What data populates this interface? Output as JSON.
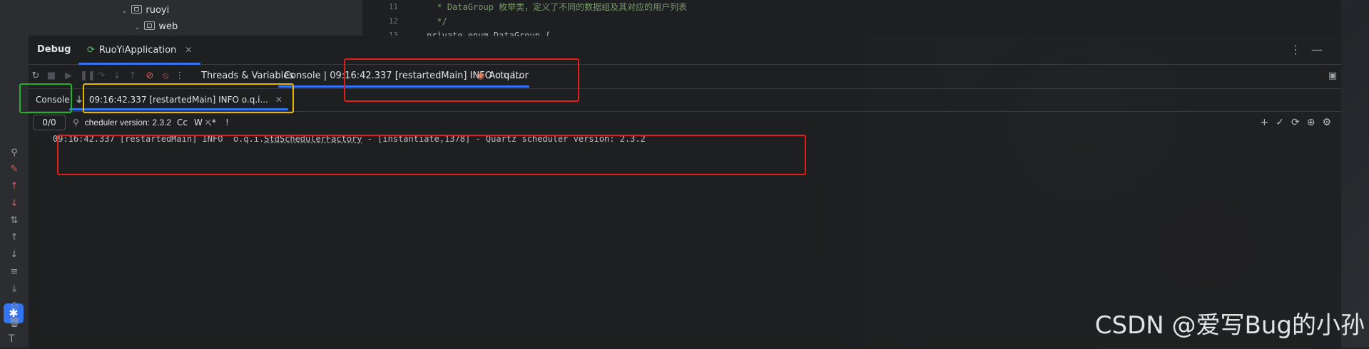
{
  "project_tree": {
    "items": [
      {
        "label": "ruoyi"
      },
      {
        "label": "web"
      }
    ]
  },
  "editor": {
    "line_numbers": [
      "11",
      "12",
      "13"
    ],
    "lines": [
      "* DataGroup 枚举类，定义了不同的数据组及其对应的用户列表",
      "*/",
      "private enum DataGroup {"
    ]
  },
  "debug": {
    "title": "Debug",
    "run_tab": "RuoYiApplication",
    "toolbar_tabs": {
      "threads": "Threads & Variables",
      "console": "Console | 09:16:42.337 [restartedMain] INFO  o.q.i...",
      "actuator": "Actuator"
    },
    "sub_tabs": {
      "console": "Console",
      "filter": "09:16:42.337 [restartedMain] INFO  o.q.i..."
    },
    "search": {
      "counter": "0/0",
      "value": "cheduler version: 2.3.2",
      "options": {
        "case": "Cc",
        "word": "W",
        "regex": ".*",
        "alert": "!"
      }
    },
    "log_line": {
      "prefix": "09:16:42.337 [restartedMain] INFO  o.q.i.",
      "class": "StdSchedulerFactory",
      "suffix": " - [instantiate,1378] - Quartz scheduler version: 2.3.2"
    }
  },
  "watermark": "CSDN @爱写Bug的小孙",
  "colors": {
    "accent": "#3574f0",
    "highlight_red": "#e0201a",
    "highlight_green": "#22b427",
    "highlight_yellow": "#e6b800"
  }
}
